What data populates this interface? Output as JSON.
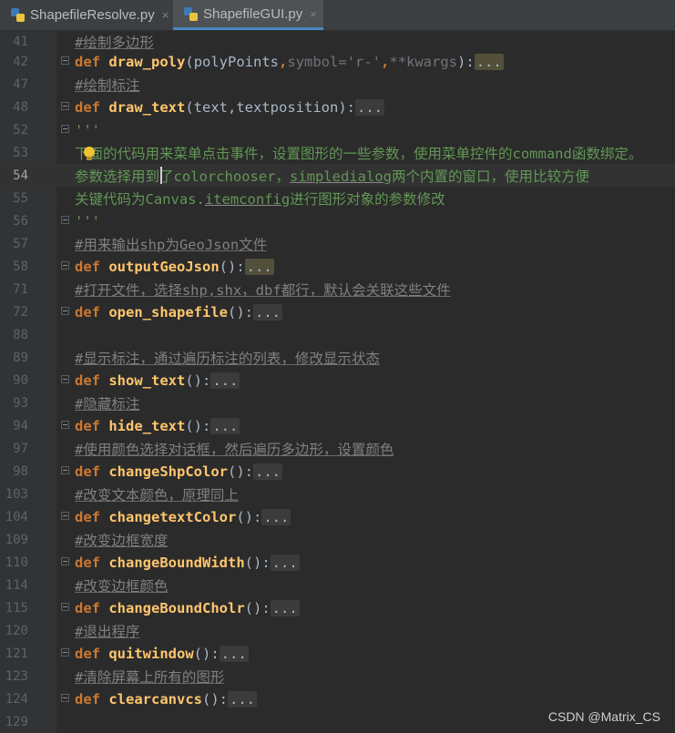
{
  "tabs": [
    {
      "label": "ShapefileResolve.py",
      "close": "×"
    },
    {
      "label": "ShapefileGUI.py",
      "close": "×"
    }
  ],
  "lines": {
    "l41": {
      "num": "41",
      "comment": "#绘制多边形"
    },
    "l42": {
      "num": "42",
      "kw": "def",
      "fn": "draw_poly",
      "open": "(",
      "p1": "polyPoints",
      "comma1": ",",
      "p2": "symbol=",
      "str": "'r-'",
      "comma2": ",",
      "p3": "**kwargs",
      "close": "):",
      "ell": "..."
    },
    "l47": {
      "num": "47",
      "comment": "#绘制标注"
    },
    "l48": {
      "num": "48",
      "kw": "def",
      "fn": "draw_text",
      "params": "(text,textposition):",
      "ell": "..."
    },
    "l52": {
      "num": "52",
      "doc": "'''"
    },
    "l53": {
      "num": "53",
      "doc": "下面的代码用来菜单点击事件，设置图形的一些参数，使用菜单控件的command函数绑定。"
    },
    "l54": {
      "num": "54",
      "doc_a": "参数选择用到了colorchooser，",
      "doc_b": "simpledialog",
      "doc_c": "两个内置的窗口，使用比较方便"
    },
    "l55": {
      "num": "55",
      "doc_a": "关键代码为Canvas.",
      "doc_b": "itemconfig",
      "doc_c": "进行图形对象的参数修改"
    },
    "l56": {
      "num": "56",
      "doc": "'''"
    },
    "l57": {
      "num": "57",
      "comment": "#用来输出shp为GeoJson文件"
    },
    "l58": {
      "num": "58",
      "kw": "def",
      "fn": "outputGeoJson",
      "params": "():",
      "ell": "..."
    },
    "l71": {
      "num": "71",
      "comment": "#打开文件，选择shp,shx，dbf都行，默认会关联这些文件"
    },
    "l72": {
      "num": "72",
      "kw": "def",
      "fn": "open_shapefile",
      "params": "():",
      "ell": "..."
    },
    "l88": {
      "num": "88"
    },
    "l89": {
      "num": "89",
      "comment": "#显示标注，通过遍历标注的列表，修改显示状态"
    },
    "l90": {
      "num": "90",
      "kw": "def",
      "fn": "show_text",
      "params": "():",
      "ell": "..."
    },
    "l93": {
      "num": "93",
      "comment": "#隐藏标注"
    },
    "l94": {
      "num": "94",
      "kw": "def",
      "fn": "hide_text",
      "params": "():",
      "ell": "..."
    },
    "l97": {
      "num": "97",
      "comment": "#使用颜色选择对话框，然后遍历多边形，设置颜色"
    },
    "l98": {
      "num": "98",
      "kw": "def",
      "fn": "changeShpColor",
      "params": "():",
      "ell": "..."
    },
    "l103": {
      "num": "103",
      "comment": "#改变文本颜色，原理同上"
    },
    "l104": {
      "num": "104",
      "kw": "def",
      "fn": "changetextColor",
      "params": "():",
      "ell": "..."
    },
    "l109": {
      "num": "109",
      "comment": "#改变边框宽度"
    },
    "l110": {
      "num": "110",
      "kw": "def",
      "fn": "changeBoundWidth",
      "params": "():",
      "ell": "..."
    },
    "l114": {
      "num": "114",
      "comment": "#改变边框颜色"
    },
    "l115": {
      "num": "115",
      "kw": "def",
      "fn": "changeBoundCholr",
      "params": "():",
      "ell": "..."
    },
    "l120": {
      "num": "120",
      "comment": "#退出程序"
    },
    "l121": {
      "num": "121",
      "kw": "def",
      "fn": "quitwindow",
      "params": "():",
      "ell": "..."
    },
    "l123": {
      "num": "123",
      "comment": "#清除屏幕上所有的图形"
    },
    "l124": {
      "num": "124",
      "kw": "def",
      "fn": "clearcanvcs",
      "params": "():",
      "ell": "..."
    },
    "l129": {
      "num": "129"
    }
  },
  "watermark": "CSDN @Matrix_CS",
  "colors": {
    "background": "#2b2b2b",
    "keyword": "#cc7832",
    "function": "#ffc66d",
    "comment": "#808080",
    "docstring": "#629755"
  },
  "icons": [
    "python-file-icon",
    "close-icon",
    "fold-icon",
    "intention-bulb-icon"
  ]
}
